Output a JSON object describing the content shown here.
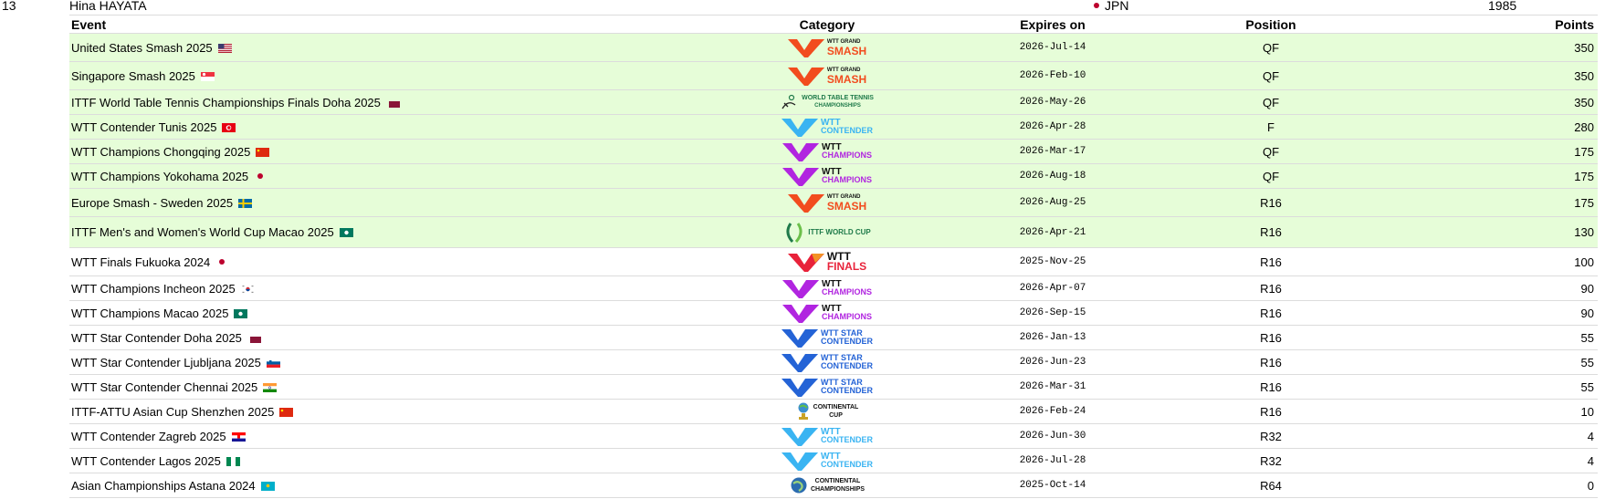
{
  "player": {
    "rank": "13",
    "name": "Hina HAYATA",
    "country": "JPN",
    "year": "1985"
  },
  "headers": {
    "event": "Event",
    "category": "Category",
    "expires": "Expires on",
    "position": "Position",
    "points": "Points"
  },
  "categories": {
    "grand_smash": {
      "icon": "wtt-grand-smash-logo",
      "line1": "WTT GRAND",
      "line2": "SMASH",
      "color": "#f24c1e"
    },
    "wttc": {
      "icon": "world-table-tennis-championships-logo",
      "line1": "WORLD TABLE TENNIS",
      "line2": "CHAMPIONSHIPS",
      "color": "#1f7a4a"
    },
    "contender": {
      "icon": "wtt-contender-logo",
      "line1": "WTT",
      "line2": "CONTENDER",
      "color": "#3ab4f2"
    },
    "champions": {
      "icon": "wtt-champions-logo",
      "line1": "WTT",
      "line2": "CHAMPIONS",
      "color": "#b125e0"
    },
    "world_cup": {
      "icon": "ittf-world-cup-logo",
      "line1": "ITTF WORLD CUP",
      "line2": "",
      "color": "#1f7a4a"
    },
    "finals": {
      "icon": "wtt-finals-logo",
      "line1": "WTT",
      "line2": "FINALS",
      "color": "#e8223a"
    },
    "star_contender": {
      "icon": "wtt-star-contender-logo",
      "line1": "WTT STAR",
      "line2": "CONTENDER",
      "color": "#2463d6"
    },
    "continental_cup": {
      "icon": "continental-cup-logo",
      "line1": "CONTINENTAL",
      "line2": "CUP",
      "color": "#111111"
    },
    "continental_champs": {
      "icon": "continental-championships-logo",
      "line1": "CONTINENTAL",
      "line2": "CHAMPIONSHIPS",
      "color": "#111111"
    }
  },
  "rows": [
    {
      "event": "United States Smash 2025",
      "flag": "usa",
      "category": "grand_smash",
      "expires": "2026-Jul-14",
      "position": "QF",
      "points": "350",
      "highlight": true,
      "height": 31
    },
    {
      "event": "Singapore Smash 2025",
      "flag": "sgp",
      "category": "grand_smash",
      "expires": "2026-Feb-10",
      "position": "QF",
      "points": "350",
      "highlight": true,
      "height": 31
    },
    {
      "event": "ITTF World Table Tennis Championships Finals Doha 2025",
      "flag": "qat",
      "category": "wttc",
      "expires": "2026-May-26",
      "position": "QF",
      "points": "350",
      "highlight": true,
      "height": 27
    },
    {
      "event": "WTT Contender Tunis 2025",
      "flag": "tun",
      "category": "contender",
      "expires": "2026-Apr-28",
      "position": "F",
      "points": "280",
      "highlight": true,
      "height": 27
    },
    {
      "event": "WTT Champions Chongqing 2025",
      "flag": "chn",
      "category": "champions",
      "expires": "2026-Mar-17",
      "position": "QF",
      "points": "175",
      "highlight": true,
      "height": 27
    },
    {
      "event": "WTT Champions Yokohama 2025",
      "flag": "jpn",
      "category": "champions",
      "expires": "2026-Aug-18",
      "position": "QF",
      "points": "175",
      "highlight": true,
      "height": 27
    },
    {
      "event": "Europe Smash - Sweden 2025",
      "flag": "swe",
      "category": "grand_smash",
      "expires": "2026-Aug-25",
      "position": "R16",
      "points": "175",
      "highlight": true,
      "height": 31
    },
    {
      "event": "ITTF Men's and Women's World Cup Macao 2025",
      "flag": "mac",
      "category": "world_cup",
      "expires": "2026-Apr-21",
      "position": "R16",
      "points": "130",
      "highlight": true,
      "height": 34
    },
    {
      "event": "WTT Finals Fukuoka 2024",
      "flag": "jpn",
      "category": "finals",
      "expires": "2025-Nov-25",
      "position": "R16",
      "points": "100",
      "highlight": false,
      "height": 31
    },
    {
      "event": "WTT Champions Incheon 2025",
      "flag": "kor",
      "category": "champions",
      "expires": "2026-Apr-07",
      "position": "R16",
      "points": "90",
      "highlight": false,
      "height": 27
    },
    {
      "event": "WTT Champions Macao 2025",
      "flag": "mac",
      "category": "champions",
      "expires": "2026-Sep-15",
      "position": "R16",
      "points": "90",
      "highlight": false,
      "height": 27
    },
    {
      "event": "WTT Star Contender Doha 2025",
      "flag": "qat",
      "category": "star_contender",
      "expires": "2026-Jan-13",
      "position": "R16",
      "points": "55",
      "highlight": false,
      "height": 27
    },
    {
      "event": "WTT Star Contender Ljubljana 2025",
      "flag": "svn",
      "category": "star_contender",
      "expires": "2026-Jun-23",
      "position": "R16",
      "points": "55",
      "highlight": false,
      "height": 27
    },
    {
      "event": "WTT Star Contender Chennai 2025",
      "flag": "ind",
      "category": "star_contender",
      "expires": "2026-Mar-31",
      "position": "R16",
      "points": "55",
      "highlight": false,
      "height": 27
    },
    {
      "event": "ITTF-ATTU Asian Cup Shenzhen 2025",
      "flag": "chn",
      "category": "continental_cup",
      "expires": "2026-Feb-24",
      "position": "R16",
      "points": "10",
      "highlight": false,
      "height": 27
    },
    {
      "event": "WTT Contender Zagreb 2025",
      "flag": "cro",
      "category": "contender",
      "expires": "2026-Jun-30",
      "position": "R32",
      "points": "4",
      "highlight": false,
      "height": 27
    },
    {
      "event": "WTT Contender Lagos 2025",
      "flag": "nga",
      "category": "contender",
      "expires": "2026-Jul-28",
      "position": "R32",
      "points": "4",
      "highlight": false,
      "height": 27
    },
    {
      "event": "Asian Championships Astana 2024",
      "flag": "kaz",
      "category": "continental_champs",
      "expires": "2025-Oct-14",
      "position": "R64",
      "points": "0",
      "highlight": false,
      "height": 27
    }
  ]
}
